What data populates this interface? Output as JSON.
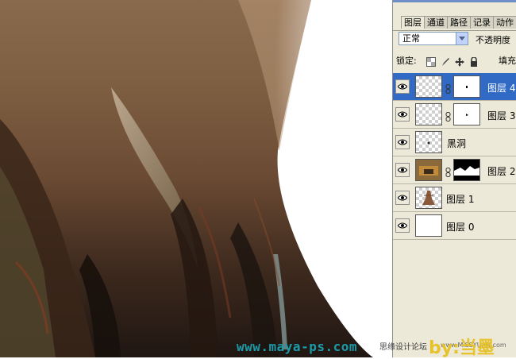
{
  "canvas": {
    "name": "artwork-canvas"
  },
  "panel": {
    "tabs": [
      {
        "label": "图层",
        "active": true
      },
      {
        "label": "通道",
        "active": false
      },
      {
        "label": "路径",
        "active": false
      },
      {
        "label": "记录",
        "active": false
      },
      {
        "label": "动作",
        "active": false
      }
    ],
    "blend_mode": "正常",
    "opacity_label": "不透明度",
    "lock_label": "锁定:",
    "fill_label": "填充",
    "lock_icons": [
      "lock-transparent-icon",
      "lock-paint-icon",
      "lock-move-icon",
      "lock-all-icon"
    ],
    "layers": [
      {
        "name": "图层 4",
        "selected": true,
        "has_mask": true,
        "eye": "eye-icon"
      },
      {
        "name": "图层 3",
        "selected": false,
        "has_mask": true,
        "eye": "eye-icon"
      },
      {
        "name": "黑洞",
        "selected": false,
        "has_mask": false,
        "eye": "eye-icon"
      },
      {
        "name": "图层 2",
        "selected": false,
        "has_mask": true,
        "eye": "eye-icon"
      },
      {
        "name": "图层 1",
        "selected": false,
        "has_mask": false,
        "eye": "eye-icon"
      },
      {
        "name": "图层 0",
        "selected": false,
        "has_mask": false,
        "eye": "eye-icon"
      }
    ]
  },
  "watermark": {
    "site": "www.maya-ps.com",
    "forum": "思缘设计论坛",
    "url": "www.MISSYUAN.com",
    "by": "by:当墨"
  },
  "colors": {
    "selection": "#316ac5",
    "panel_bg": "#ece9d8",
    "watermark_teal": "#1b9aa8",
    "watermark_gold": "#e6c22c"
  }
}
